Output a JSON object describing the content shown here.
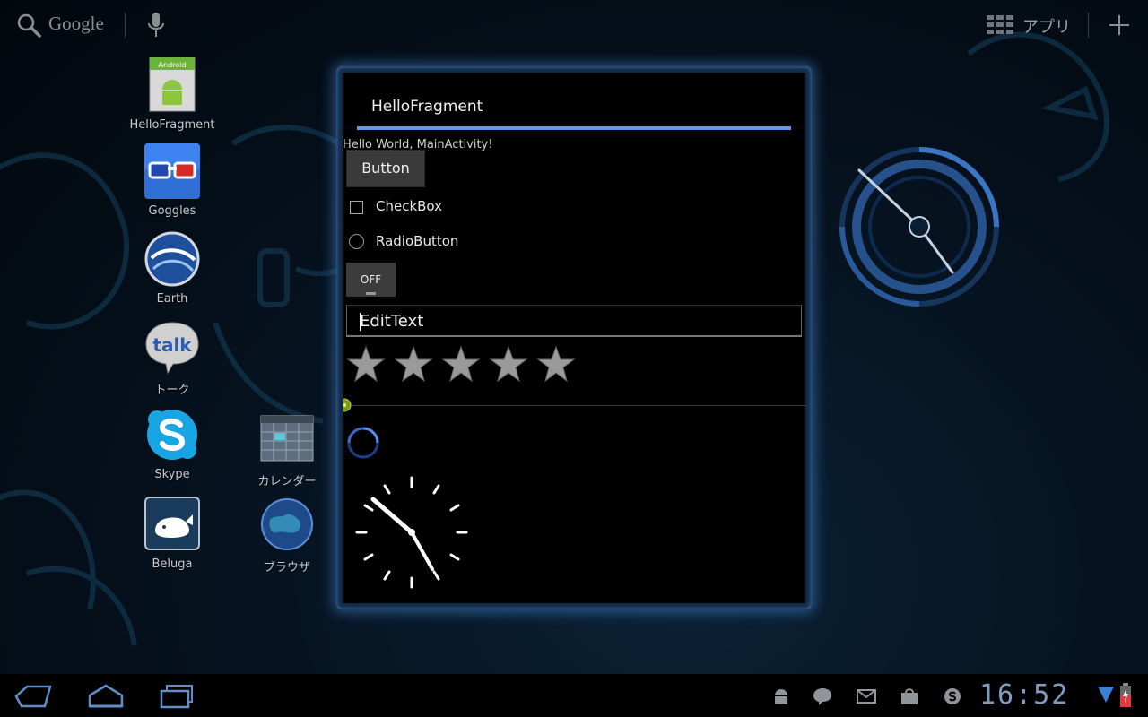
{
  "top_bar": {
    "search_label": "Google",
    "apps_label": "アプリ",
    "icons": [
      "search-icon",
      "mic-icon",
      "apps-grid-icon",
      "add-icon"
    ]
  },
  "desktop": {
    "apps": [
      {
        "label": "HelloFragment",
        "icon": "android-app-icon",
        "icon_text": "Android"
      },
      {
        "label": "Goggles",
        "icon": "goggles-icon"
      },
      {
        "label": "Earth",
        "icon": "earth-icon"
      },
      {
        "label": "トーク",
        "icon": "talk-icon",
        "icon_text": "talk"
      },
      {
        "label": "Skype",
        "icon": "skype-icon"
      },
      {
        "label": "Beluga",
        "icon": "beluga-icon"
      },
      {
        "label": "カレンダー",
        "icon": "calendar-icon"
      },
      {
        "label": "ブラウザ",
        "icon": "browser-icon"
      }
    ]
  },
  "window": {
    "title": "HelloFragment",
    "hello_text": "Hello World, MainActivity!",
    "button_label": "Button",
    "checkbox_label": "CheckBox",
    "checkbox_checked": false,
    "radio_label": "RadioButton",
    "radio_checked": false,
    "toggle_label": "OFF",
    "edittext_value": "EditText",
    "rating": {
      "value": 0,
      "max": 5
    },
    "seekbar_progress": 0,
    "accent_color": "#5b9af0"
  },
  "status_bar": {
    "time": "16:52",
    "notification_icons": [
      "android-icon",
      "talk-icon",
      "gmail-icon",
      "market-icon",
      "skype-icon"
    ],
    "system_icons": [
      "wifi-icon",
      "battery-icon"
    ]
  },
  "nav_bar": {
    "icons": [
      "back-icon",
      "home-icon",
      "recent-apps-icon"
    ]
  }
}
